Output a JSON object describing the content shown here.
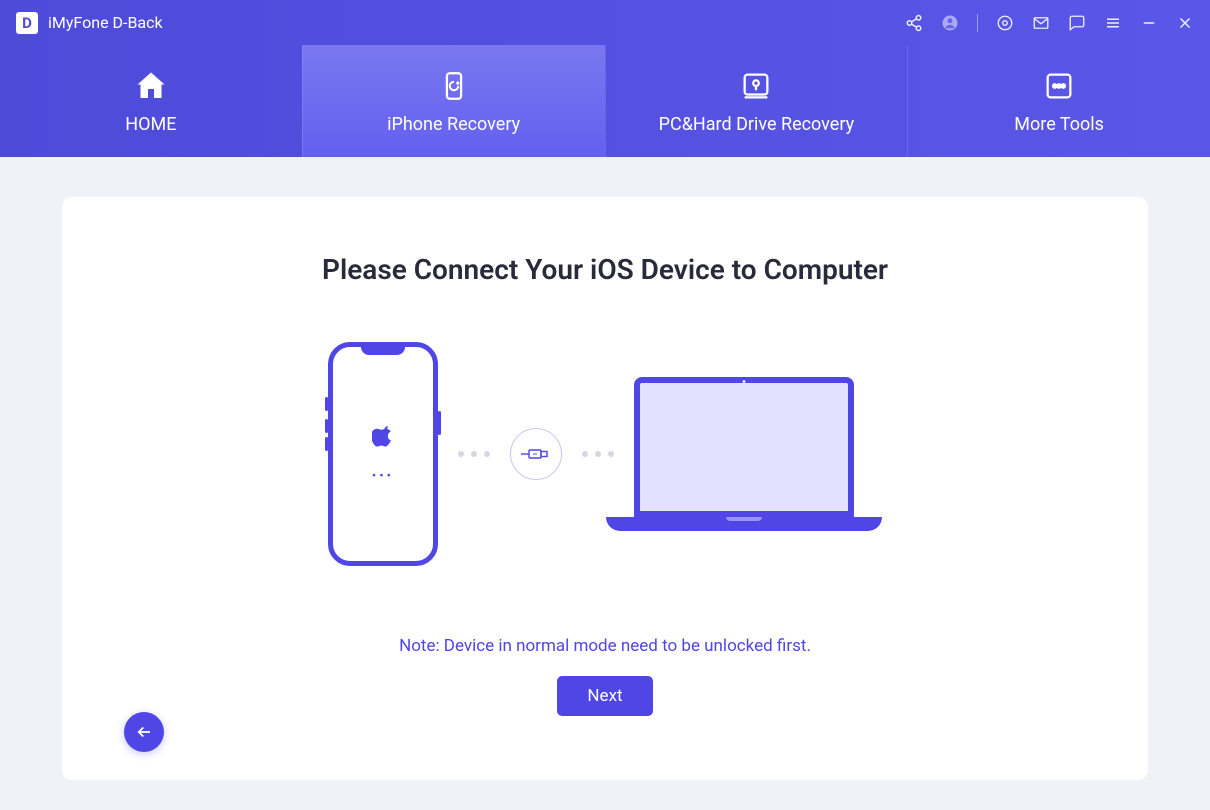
{
  "app": {
    "logo_letter": "D",
    "title": "iMyFone D-Back"
  },
  "nav": {
    "items": [
      {
        "label": "HOME"
      },
      {
        "label": "iPhone Recovery"
      },
      {
        "label": "PC&Hard Drive Recovery"
      },
      {
        "label": "More Tools"
      }
    ],
    "active_index": 1
  },
  "main": {
    "headline": "Please Connect Your iOS Device to Computer",
    "phone_dots": "•••",
    "note": "Note: Device in normal mode need to be unlocked first.",
    "next_label": "Next"
  },
  "colors": {
    "accent": "#4f46e5",
    "grad_a": "#4f4bd9",
    "grad_b": "#5a56e8"
  }
}
